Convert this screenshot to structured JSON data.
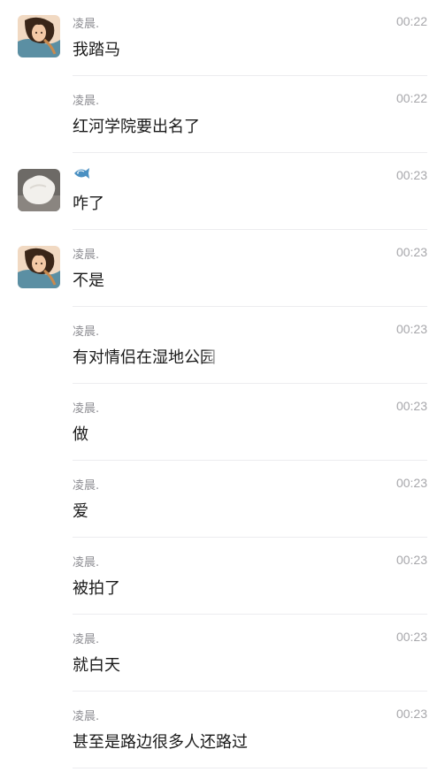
{
  "messages": [
    {
      "sender": "凌晨.",
      "time": "00:22",
      "text": "我踏马",
      "avatar": "girl-avatar"
    },
    {
      "sender": "凌晨.",
      "time": "00:22",
      "text": "红河学院要出名了",
      "avatar": null
    },
    {
      "sender": "",
      "sender_icon": "fish-icon",
      "time": "00:23",
      "text": "咋了",
      "avatar": "white-object-avatar"
    },
    {
      "sender": "凌晨.",
      "time": "00:23",
      "text": "不是",
      "avatar": "girl-avatar"
    },
    {
      "sender": "凌晨.",
      "time": "00:23",
      "text": "有对情侣在湿地公园",
      "avatar": null
    },
    {
      "sender": "凌晨.",
      "time": "00:23",
      "text": "做",
      "avatar": null
    },
    {
      "sender": "凌晨.",
      "time": "00:23",
      "text": "爱",
      "avatar": null
    },
    {
      "sender": "凌晨.",
      "time": "00:23",
      "text": "被拍了",
      "avatar": null
    },
    {
      "sender": "凌晨.",
      "time": "00:23",
      "text": "就白天",
      "avatar": null
    },
    {
      "sender": "凌晨.",
      "time": "00:23",
      "text": "甚至是路边很多人还路过",
      "avatar": null
    }
  ],
  "colors": {
    "sender": "#8e8e93",
    "time": "#a7a7ab",
    "text": "#1a1a1a",
    "divider": "#ececef"
  }
}
